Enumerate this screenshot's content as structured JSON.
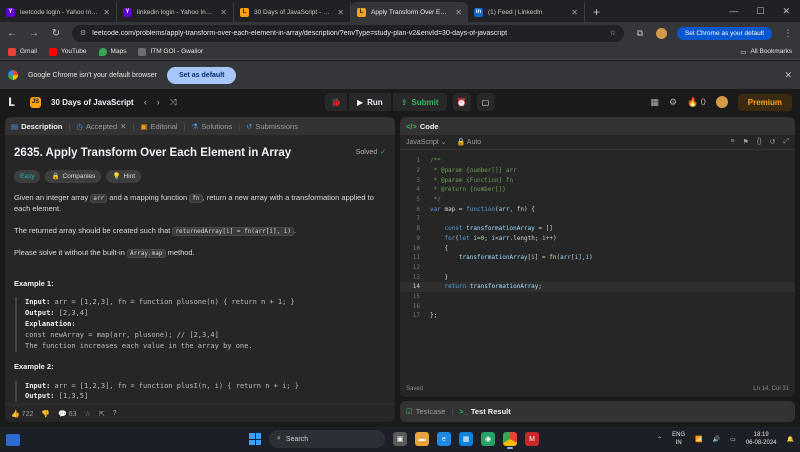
{
  "browser": {
    "tabs": [
      {
        "title": "leetcode login - Yahoo India Se",
        "favicon": "yahoo-icon",
        "color": "#6001d2",
        "active": false
      },
      {
        "title": "linkedin login - Yahoo India Se",
        "favicon": "yahoo-icon",
        "color": "#6001d2",
        "active": false
      },
      {
        "title": "30 Days of JavaScript - Study Pl",
        "favicon": "leetcode-icon",
        "color": "#ffa116",
        "active": false
      },
      {
        "title": "Apply Transform Over Each Elem",
        "favicon": "leetcode-icon",
        "color": "#ffa116",
        "active": true
      },
      {
        "title": "(1) Feed | LinkedIn",
        "favicon": "linkedin-icon",
        "color": "#0a66c2",
        "active": false
      }
    ],
    "url": "leetcode.com/problems/apply-transform-over-each-element-in-array/description/?envType=study-plan-v2&envId=30-days-of-javascript",
    "set_default_chip": "Set Chrome as your default",
    "bookmarks": [
      {
        "label": "Gmail",
        "color": "#ea4335"
      },
      {
        "label": "YouTube",
        "color": "#ff0000"
      },
      {
        "label": "Maps",
        "color": "#34a853"
      },
      {
        "label": "ITM GOI - Gwalior",
        "color": "#6d6d6d"
      }
    ],
    "all_bookmarks": "All Bookmarks",
    "infobar_text": "Google Chrome isn't your default browser",
    "infobar_button": "Set as default"
  },
  "header": {
    "study_plan": "30 Days of JavaScript",
    "run": "Run",
    "submit": "Submit",
    "fire_count": "0",
    "premium": "Premium"
  },
  "description": {
    "tabs": [
      "Description",
      "Accepted",
      "Editorial",
      "Solutions",
      "Submissions"
    ],
    "title": "2635. Apply Transform Over Each Element in Array",
    "solved": "Solved",
    "pills": [
      "Easy",
      "Companies",
      "Hint"
    ],
    "p1_a": "Given an integer array ",
    "p1_code1": "arr",
    "p1_b": " and a mapping function ",
    "p1_code2": "fn",
    "p1_c": ", return a new array with a transformation applied to each element.",
    "p2_a": "The returned array should be created such that ",
    "p2_code": "returnedArray[i] = fn(arr[i], i)",
    "p2_b": ".",
    "p3_a": "Please solve it without the built-in ",
    "p3_code": "Array.map",
    "p3_b": " method.",
    "example1": {
      "title": "Example 1:",
      "input_label": "Input:",
      "input": "arr = [1,2,3], fn = function plusone(n) { return n + 1; }",
      "output_label": "Output:",
      "output": "[2,3,4]",
      "explanation_label": "Explanation:",
      "explanation_1": "const newArray = map(arr, plusone); // [2,3,4]",
      "explanation_2": "The function increases each value in the array by one."
    },
    "example2": {
      "title": "Example 2:",
      "input_label": "Input:",
      "input": "arr = [1,2,3], fn = function plusI(n, i) { return n + i; }",
      "output_label": "Output:",
      "output": "[1,3,5]"
    },
    "likes": "722",
    "comments": "63"
  },
  "code": {
    "tab": "Code",
    "language": "JavaScript",
    "auto": "Auto",
    "lines": [
      "/**",
      " * @param {number[]} arr",
      " * @param {Function} fn",
      " * @return {number[]}",
      " */",
      "var map = function(arr, fn) {",
      "",
      "    const transformationArray = []",
      "    for(let i=0; i<arr.length; i++)",
      "    {",
      "        transformationArray[i] = fn(arr[i],i)",
      "",
      "    }",
      "    return transformationArray;",
      "",
      "",
      "};"
    ],
    "status_left": "Saved",
    "status_right": "Ln 14, Col 31"
  },
  "tests": {
    "testcase": "Testcase",
    "result": "Test Result"
  },
  "taskbar": {
    "search": "Search",
    "lang_1": "ENG",
    "lang_2": "IN",
    "time": "18:19",
    "date": "06-08-2024"
  }
}
